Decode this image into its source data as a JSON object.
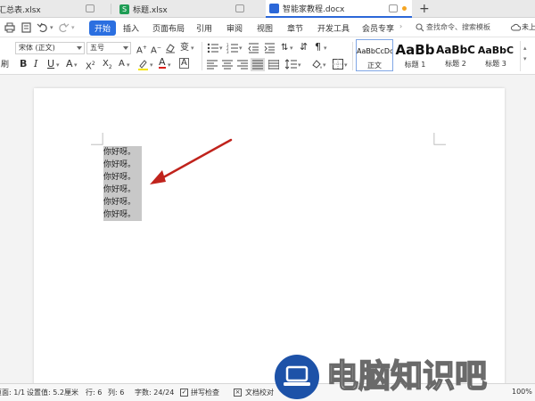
{
  "tabs": [
    {
      "label": "汇总表.xlsx",
      "active": false
    },
    {
      "label": "标题.xlsx",
      "active": false
    },
    {
      "label": "智能家教程.docx",
      "active": true
    }
  ],
  "new_tab_symbol": "+",
  "menu": {
    "start": "开始",
    "items": [
      "插入",
      "页面布局",
      "引用",
      "审阅",
      "视图",
      "章节",
      "开发工具",
      "会员专享"
    ],
    "search_placeholder": "查找命令、搜索模板",
    "cloud_label": "未上"
  },
  "toolbar": {
    "left_stub": "刷",
    "font_name": "宋体 (正文)",
    "font_size": "五号",
    "styles": [
      {
        "sample": "AaBbCcDd",
        "label": "正文"
      },
      {
        "sample": "AaBb",
        "label": "标题 1"
      },
      {
        "sample": "AaBbC",
        "label": "标题 2"
      },
      {
        "sample": "AaBbC",
        "label": "标题 3"
      }
    ]
  },
  "document": {
    "lines": [
      "你好呀。",
      "你好呀。",
      "你好呀。",
      "你好呀。",
      "你好呀。",
      "你好呀。"
    ]
  },
  "status": {
    "page": "页面: 1/1",
    "position": "设置值: 5.2厘米",
    "row": "行: 6",
    "col": "列: 6",
    "wordcount": "字数: 24/24",
    "spellcheck": "拼写检查",
    "proofread": "文档校对",
    "zoom": "100%"
  },
  "watermark_text": "电脑知识吧",
  "colors": {
    "accent": "#2b6fe0",
    "selection": "#c8c8c8",
    "arrow": "#c0231c",
    "xlsx_badge": "#1f9d55",
    "docx_badge": "#2b67d8",
    "watermark_circle": "#1d52a8"
  }
}
